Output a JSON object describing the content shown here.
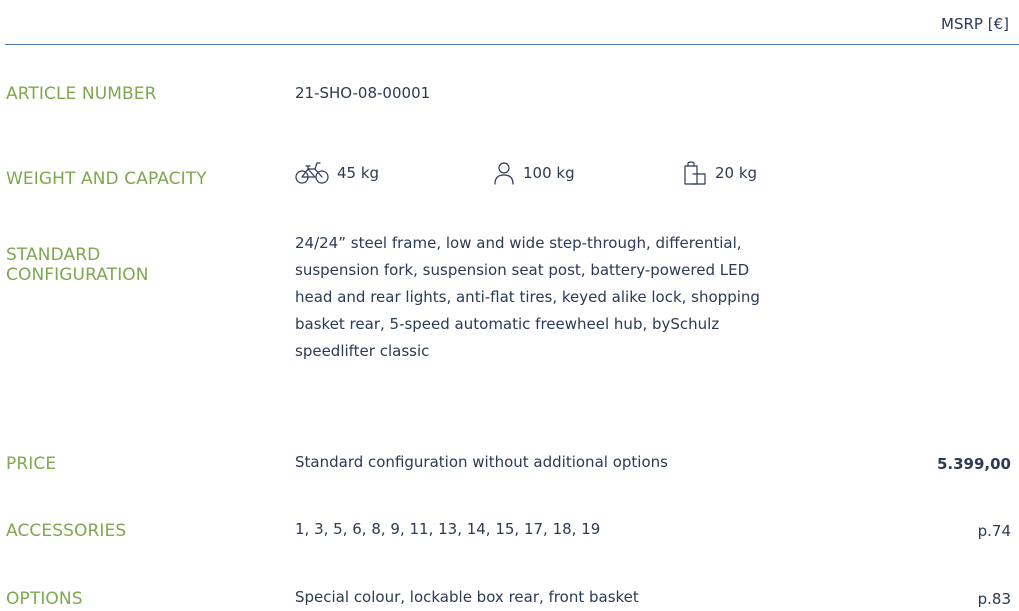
{
  "header": {
    "msrp_label": "MSRP [€]"
  },
  "rows": {
    "article": {
      "label": "ARTICLE NUMBER",
      "value": "21-SHO-08-00001"
    },
    "weight": {
      "label": "WEIGHT AND CAPACITY",
      "items": [
        {
          "icon": "bicycle-icon",
          "value": "45 kg"
        },
        {
          "icon": "person-icon",
          "value": "100 kg"
        },
        {
          "icon": "luggage-icon",
          "value": "20 kg"
        }
      ]
    },
    "standard": {
      "label_line1": "STANDARD",
      "label_line2": "CONFIGURATION",
      "lines": [
        "24/24” steel frame, low and wide step-through, differential,",
        "suspension fork, suspension seat post, battery-powered LED",
        "head and rear lights, anti-flat tires, keyed alike lock, shopping",
        "basket rear, 5-speed automatic freewheel hub, bySchulz",
        "speedlifter classic"
      ]
    },
    "price": {
      "label": "PRICE",
      "value": "Standard configuration without additional options",
      "amount": "5.399,00"
    },
    "accessories": {
      "label": "ACCESSORIES",
      "value": "1, 3, 5, 6, 8, 9, 11, 13, 14, 15, 17, 18, 19",
      "page": "p.74"
    },
    "options": {
      "label": "OPTIONS",
      "value": "Special colour, lockable box rear, front basket",
      "page": "p.83"
    }
  },
  "colors": {
    "label_green": "#7da84e",
    "text_navy": "#2b3a55",
    "rule_blue": "#4a78a8"
  }
}
